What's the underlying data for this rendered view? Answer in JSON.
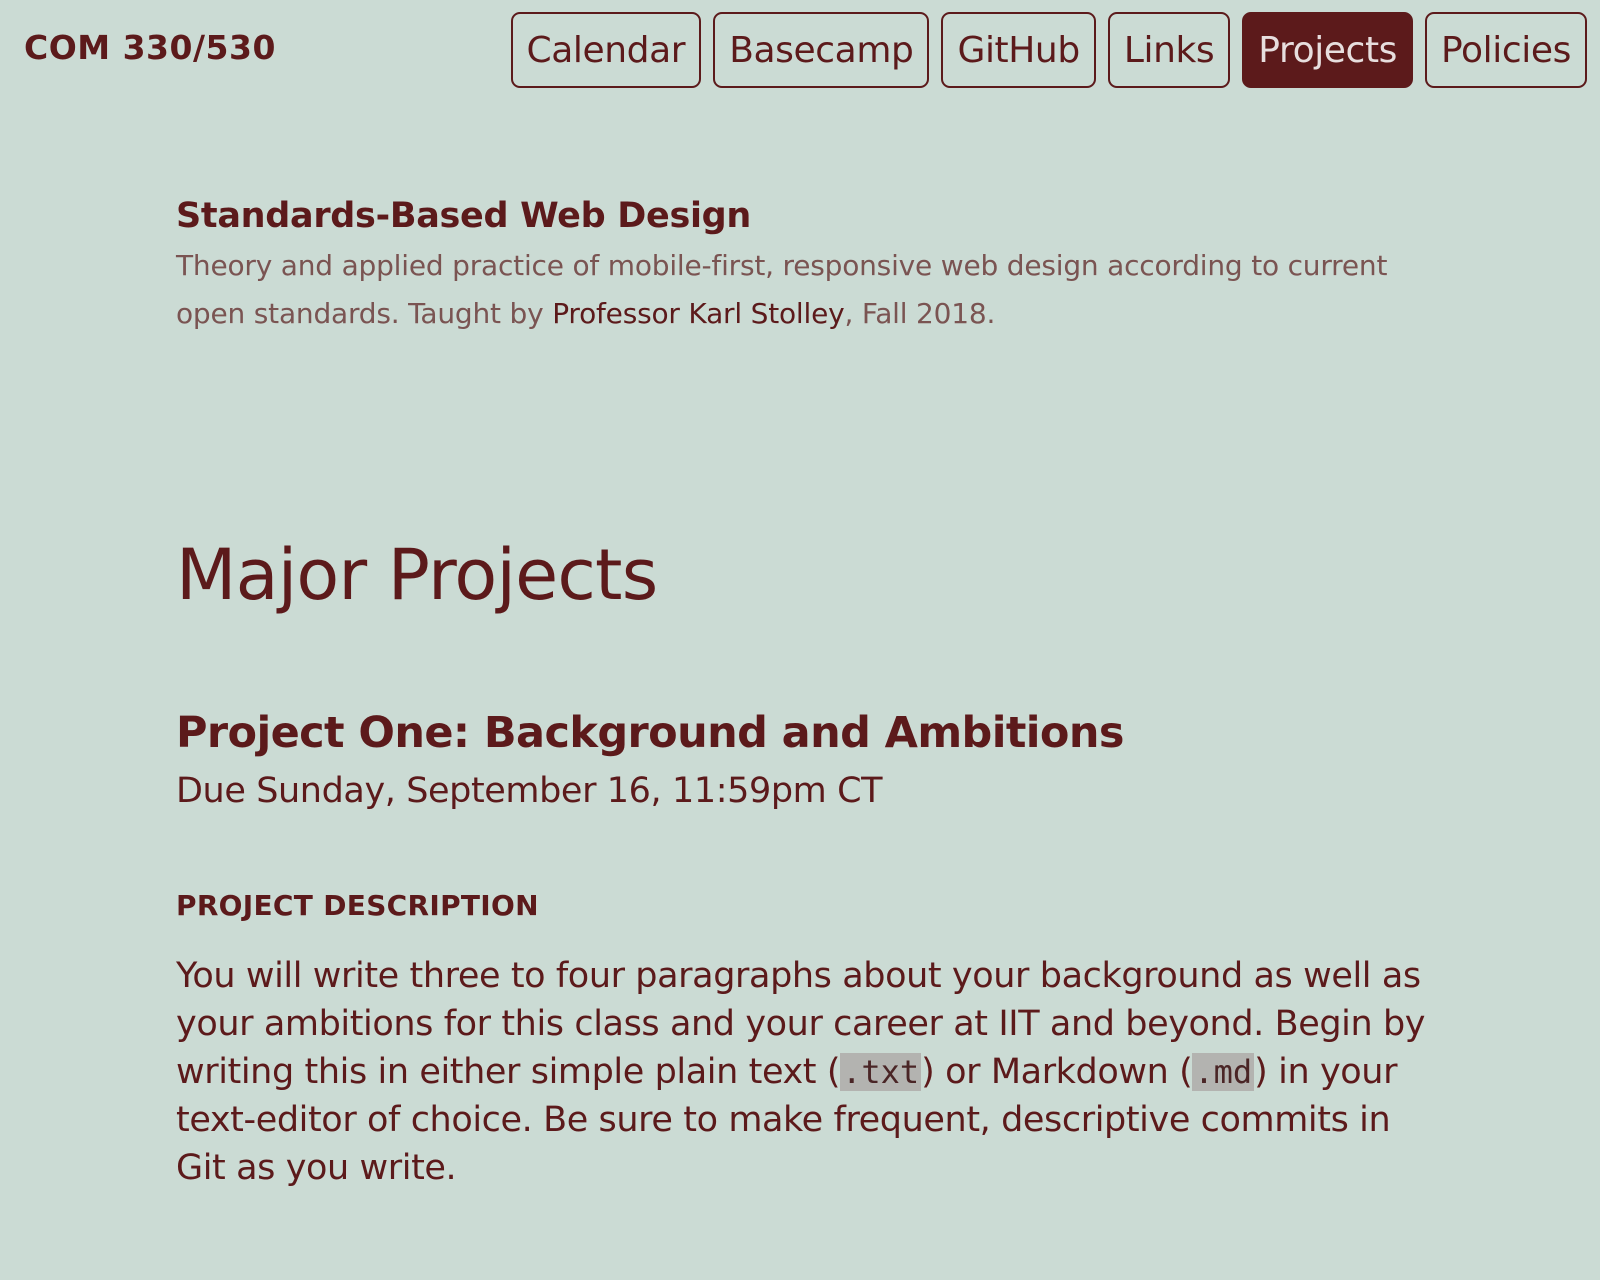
{
  "header": {
    "site_title": "COM 330/530",
    "nav": [
      {
        "label": "Calendar",
        "active": false
      },
      {
        "label": "Basecamp",
        "active": false
      },
      {
        "label": "GitHub",
        "active": false
      },
      {
        "label": "Links",
        "active": false
      },
      {
        "label": "Projects",
        "active": true
      },
      {
        "label": "Policies",
        "active": false
      }
    ]
  },
  "intro": {
    "course_name": "Standards-Based Web Design",
    "description_before": "Theory and applied practice of mobile-first, responsive web design according to current open standards. Taught by ",
    "professor_link": "Professor Karl Stolley",
    "description_after": ", Fall 2018."
  },
  "main": {
    "page_title": "Major Projects",
    "project": {
      "title": "Project One: Background and Ambitions",
      "due": "Due Sunday, September 16, 11:59pm CT",
      "section_heading": "PROJECT DESCRIPTION",
      "text_1": "You will write three to four paragraphs about your background as well as your ambitions for this class and your career at IIT and beyond. Begin by writing this in either simple plain text (",
      "code_1": ".txt",
      "text_2": ") or Markdown (",
      "code_2": ".md",
      "text_3": ") in your text-editor of choice. Be sure to make frequent, descriptive commits in Git as you write."
    }
  },
  "colors": {
    "background": "#cbdbd4",
    "accent": "#5c1a1b",
    "muted_text": "#7a5452",
    "code_background": "#b3b3b0"
  }
}
